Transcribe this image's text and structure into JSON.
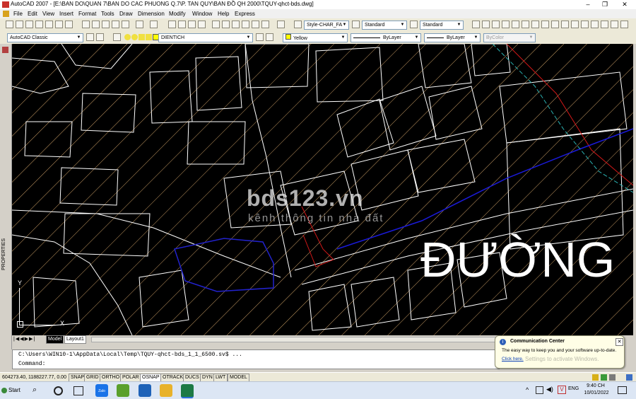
{
  "window": {
    "title": "AutoCAD 2007 - [E:\\BAN DO\\QUAN 7\\BAN DO CAC PHUONG Q.7\\P. TAN QUY\\BAN ĐỒ QH 2000\\TQUY-qhct-bds.dwg]",
    "minimize": "–",
    "restore": "❐",
    "close": "✕"
  },
  "menu": [
    "File",
    "Edit",
    "View",
    "Insert",
    "Format",
    "Tools",
    "Draw",
    "Dimension",
    "Modify",
    "Window",
    "Help",
    "Express"
  ],
  "toolbar": {
    "text_style": "Style-CHAR_FA",
    "dim_style": "Standard",
    "table_style": "Standard"
  },
  "toolbar2": {
    "workspace": "AutoCAD Classic",
    "layer": "DIENTICH",
    "color": "Yellow",
    "linetype": "ByLayer",
    "lineweight": "ByLayer",
    "plotstyle": "ByColor"
  },
  "side_panel": {
    "label": "PROPERTIES"
  },
  "drawing": {
    "watermark_main": "bds123.vn",
    "watermark_sub": "kênh thông tin nhà đất",
    "street_text": "ĐƯỜNG",
    "ucs_x": "X",
    "ucs_y": "Y",
    "colors": {
      "background": "#000000",
      "hatch": "#c89c64",
      "lines": "#ffffff",
      "red": "#d01818",
      "blue": "#1a1ad8",
      "cyan": "#2bb3b3"
    }
  },
  "layout_tabs": [
    "Model",
    "Layout1"
  ],
  "command": {
    "history": "C:\\Users\\WIN10-1\\AppData\\Local\\Temp\\TQUY-qhct-bds_1_1_6500.sv$ ...",
    "prompt": "Command:"
  },
  "status": {
    "coords": "604273.40, 1188227.77, 0.00",
    "toggles": [
      "SNAP",
      "GRID",
      "ORTHO",
      "POLAR",
      "OSNAP",
      "OTRACK",
      "DUCS",
      "DYN",
      "LWT",
      "MODEL"
    ]
  },
  "comm_center": {
    "title": "Communication Center",
    "message": "The easy way to keep you and your software up-to-date.",
    "link": "Click here.",
    "activate": "Settings to activate Windows."
  },
  "taskbar": {
    "start": "Start",
    "apps": [
      "Zalo",
      "CocCoc",
      "Mail",
      "Files",
      "Excel"
    ],
    "lang": "ENG",
    "time": "9:40 CH",
    "date": "10/01/2022"
  }
}
